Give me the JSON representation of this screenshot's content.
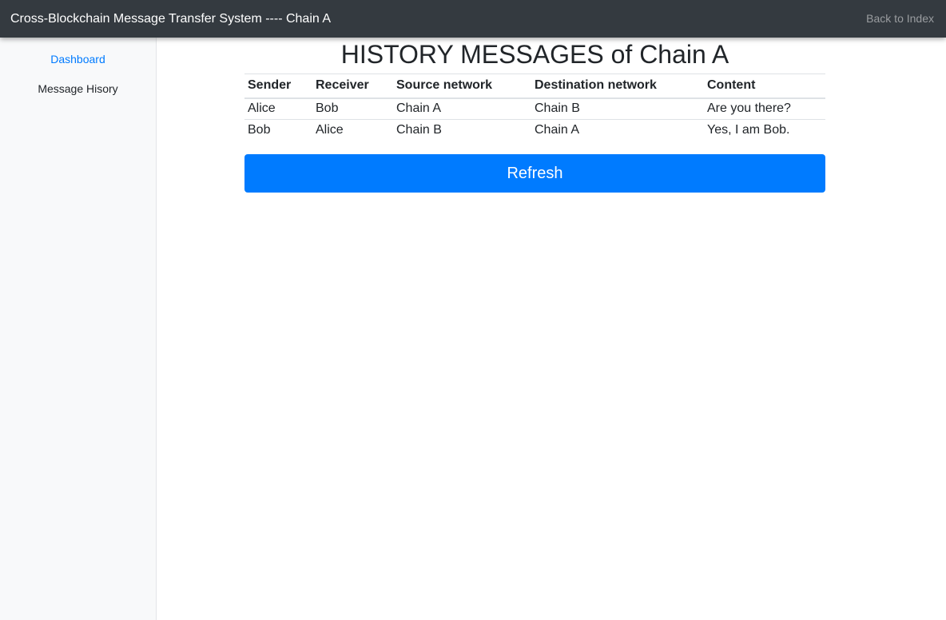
{
  "topbar": {
    "brand": "Cross-Blockchain Message Transfer System ---- Chain A",
    "back_link": "Back to Index"
  },
  "sidebar": {
    "items": [
      {
        "label": "Dashboard",
        "active": true
      },
      {
        "label": "Message Hisory",
        "active": false
      }
    ]
  },
  "main": {
    "title": "HISTORY MESSAGES of Chain A",
    "table": {
      "columns": [
        "Sender",
        "Receiver",
        "Source network",
        "Destination network",
        "Content"
      ],
      "rows": [
        [
          "Alice",
          "Bob",
          "Chain A",
          "Chain B",
          "Are you there?"
        ],
        [
          "Bob",
          "Alice",
          "Chain B",
          "Chain A",
          "Yes, I am Bob."
        ]
      ]
    },
    "refresh_label": "Refresh"
  },
  "colors": {
    "topbar_bg": "#343a40",
    "accent": "#007bff",
    "sidebar_bg": "#f8f9fa"
  }
}
